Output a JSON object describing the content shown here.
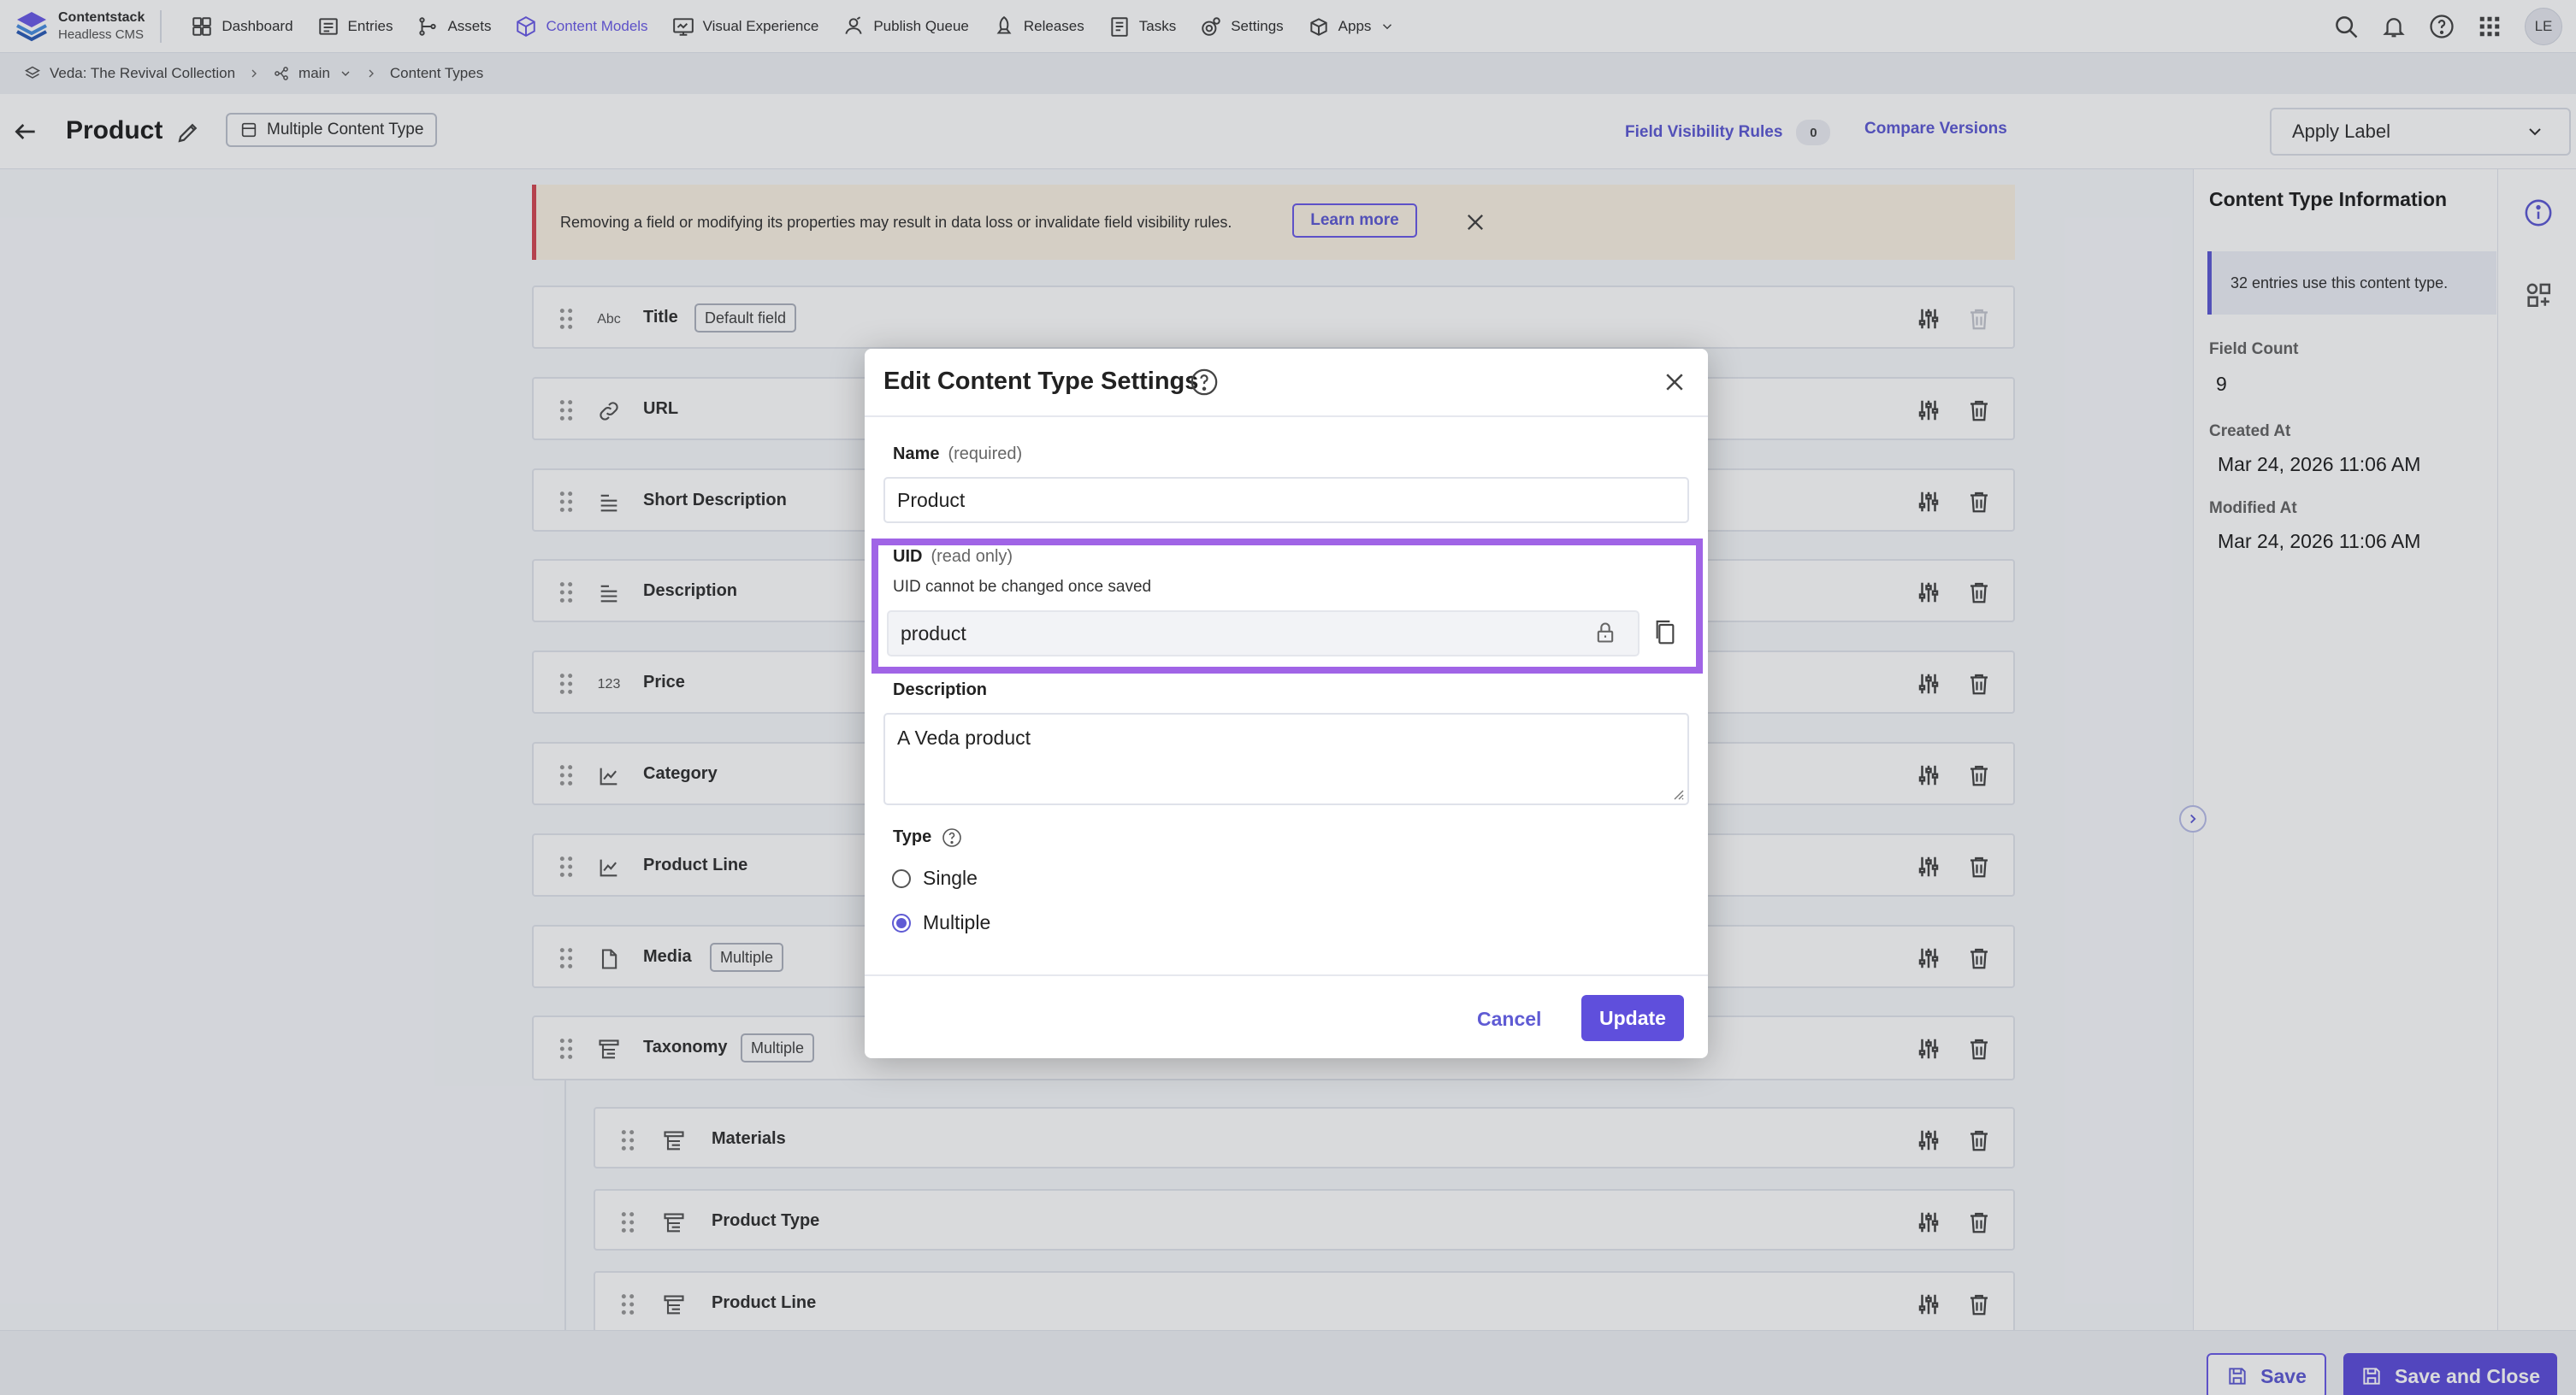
{
  "app": {
    "logo_line1": "Contentstack",
    "logo_line2": "Headless CMS",
    "nav": [
      {
        "label": "Dashboard",
        "icon": "dashboard-icon"
      },
      {
        "label": "Entries",
        "icon": "entries-icon"
      },
      {
        "label": "Assets",
        "icon": "assets-icon"
      },
      {
        "label": "Content Models",
        "icon": "content-models-icon",
        "active": true
      },
      {
        "label": "Visual Experience",
        "icon": "visual-experience-icon"
      },
      {
        "label": "Publish Queue",
        "icon": "publish-queue-icon"
      },
      {
        "label": "Releases",
        "icon": "releases-icon"
      },
      {
        "label": "Tasks",
        "icon": "tasks-icon"
      },
      {
        "label": "Settings",
        "icon": "settings-icon"
      },
      {
        "label": "Apps",
        "icon": "apps-icon"
      }
    ],
    "avatar_initials": "LE",
    "accent_color": "#5f5bd4",
    "highlight_color": "#a064e6"
  },
  "breadcrumb": {
    "stack": "Veda: The Revival Collection",
    "branch": "main",
    "section": "Content Types"
  },
  "header": {
    "title": "Product",
    "badge": "Multiple Content Type",
    "field_visibility_label": "Field Visibility Rules",
    "field_visibility_count": "0",
    "compare_label": "Compare Versions",
    "apply_label": "Apply Label"
  },
  "warning": {
    "text": "Removing a field or modifying its properties may result in data loss or invalidate field visibility rules.",
    "learn_more": "Learn more"
  },
  "fields": [
    {
      "name": "Title",
      "icon": "text-abc-icon",
      "icon_text": "Abc",
      "tag": "Default field"
    },
    {
      "name": "URL",
      "icon": "link-icon"
    },
    {
      "name": "Short Description",
      "icon": "multiline-text-icon"
    },
    {
      "name": "Description",
      "icon": "multiline-text-icon"
    },
    {
      "name": "Price",
      "icon": "number-icon",
      "icon_text": "123"
    },
    {
      "name": "Category",
      "icon": "reference-icon"
    },
    {
      "name": "Product Line",
      "icon": "reference-icon"
    },
    {
      "name": "Media",
      "icon": "file-icon",
      "tag": "Multiple"
    },
    {
      "name": "Taxonomy",
      "icon": "taxonomy-icon",
      "tag": "Multiple"
    }
  ],
  "taxonomy_children": [
    {
      "name": "Materials",
      "icon": "taxonomy-icon"
    },
    {
      "name": "Product Type",
      "icon": "taxonomy-icon"
    },
    {
      "name": "Product Line",
      "icon": "taxonomy-icon"
    }
  ],
  "info_panel": {
    "title": "Content Type Information",
    "note": "32 entries use this content type.",
    "field_count_label": "Field Count",
    "field_count": "9",
    "created_label": "Created At",
    "created_value": "Mar 24, 2026 11:06 AM",
    "modified_label": "Modified At",
    "modified_value": "Mar 24, 2026 11:06 AM"
  },
  "footer": {
    "save": "Save",
    "save_close": "Save and Close"
  },
  "modal": {
    "title": "Edit Content Type Settings",
    "name_label": "Name",
    "name_hint": "(required)",
    "name_value": "Product",
    "uid_label": "UID",
    "uid_hint": "(read only)",
    "uid_note": "UID cannot be changed once saved",
    "uid_value": "product",
    "description_label": "Description",
    "description_value": "A Veda product",
    "type_label": "Type",
    "type_options": [
      {
        "label": "Single",
        "selected": false
      },
      {
        "label": "Multiple",
        "selected": true
      }
    ],
    "cancel": "Cancel",
    "update": "Update"
  }
}
